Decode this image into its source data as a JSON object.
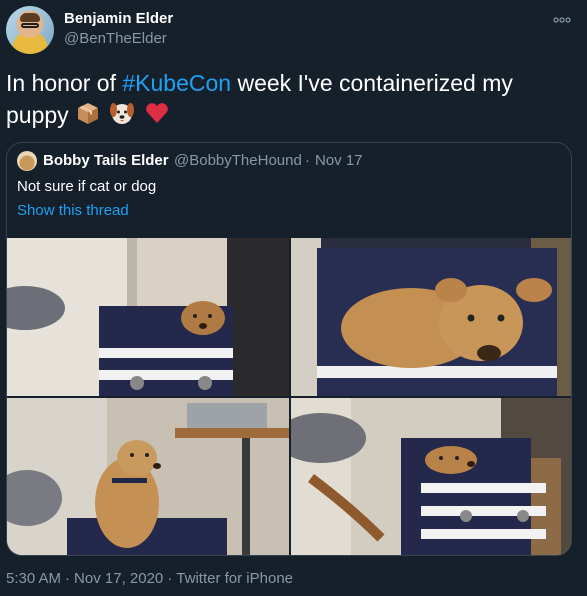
{
  "author": {
    "name": "Benjamin Elder",
    "handle": "@BenTheElder",
    "avatar_icon": "user-avatar"
  },
  "tweet": {
    "text_before": "In honor of ",
    "hashtag": "#KubeCon",
    "text_after": " week I've containerized my puppy",
    "emojis": [
      "package-icon",
      "dog-face-icon",
      "red-heart-icon"
    ]
  },
  "quote": {
    "name": "Bobby Tails Elder",
    "handle": "@BobbyTheHound",
    "separator": "·",
    "date": "Nov 17",
    "text": "Not sure if cat or dog",
    "thread_link": "Show this thread",
    "photos": [
      "dog-in-box-photo-1",
      "dog-in-box-photo-2",
      "dog-in-box-photo-3",
      "dog-in-box-photo-4"
    ]
  },
  "meta": {
    "time": "5:30 AM",
    "separator": "·",
    "date": "Nov 17, 2020",
    "source": "Twitter for iPhone"
  },
  "colors": {
    "background": "#15202b",
    "link": "#1da1f2",
    "secondary_text": "#8899a6",
    "border": "#38444d"
  }
}
